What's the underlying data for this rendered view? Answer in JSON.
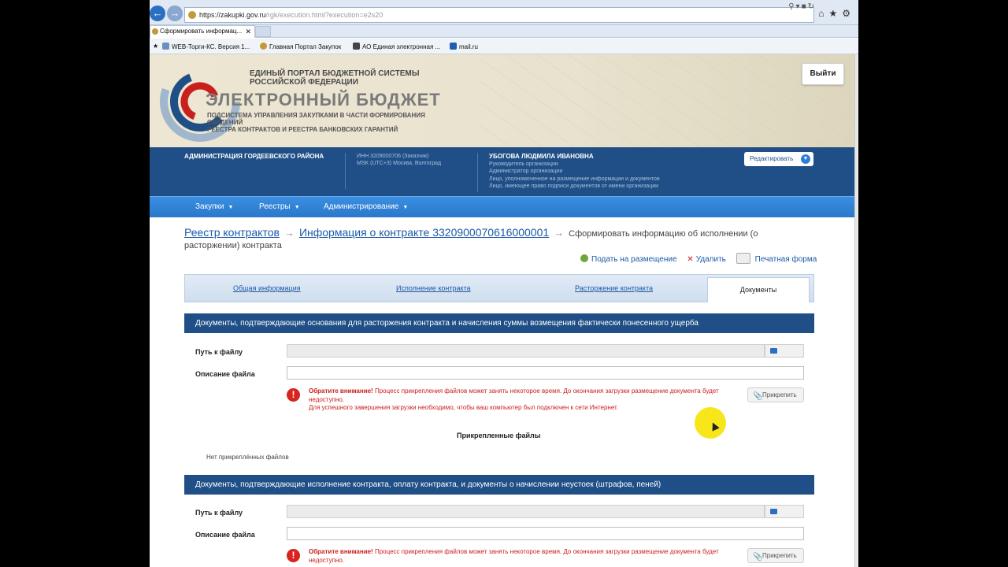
{
  "browser": {
    "url_main": "https://zakupki.gov.ru",
    "url_rest": "/rgk/execution.html?execution=e2s20",
    "tab_title": "Сформировать информац...",
    "favorites": [
      "WEB-Торги-КС. Версия 1...",
      "Главная Портал Закупок",
      "АО Единая электронная ...",
      "mail.ru"
    ]
  },
  "banner": {
    "line1": "ЕДИНЫЙ ПОРТАЛ БЮДЖЕТНОЙ СИСТЕМЫ",
    "line2": "РОССИЙСКОЙ ФЕДЕРАЦИИ",
    "title": "ЭЛЕКТРОННЫЙ БЮДЖЕТ",
    "sub1": "ПОДСИСТЕМА УПРАВЛЕНИЯ ЗАКУПКАМИ В ЧАСТИ ФОРМИРОВАНИЯ СВЕДЕНИЙ",
    "sub2": "РЕЕСТРА КОНТРАКТОВ И РЕЕСТРА БАНКОВСКИХ ГАРАНТИЙ",
    "logout": "Выйти"
  },
  "info": {
    "org": "АДМИНИСТРАЦИЯ ГОРДЕЕВСКОГО РАЙОНА",
    "inn": "ИНН 3209000706 (Заказчик)",
    "tz": "MSK (UTC+3) Москва, Волгоград",
    "user": "УБОГОВА ЛЮДМИЛА ИВАНОВНА",
    "roles": [
      "Руководитель организации",
      "Администратор организации",
      "Лицо, уполномоченное на размещение информации и документов",
      "Лицо, имеющее право подписи документов от имени организации"
    ],
    "edit": "Редактировать"
  },
  "menu": [
    "Закупки",
    "Реестры",
    "Администрирование"
  ],
  "breadcrumb": {
    "reg": "Реестр контрактов",
    "info": "Информация о контракте 3320900070616000001",
    "current": "Сформировать информацию об исполнении (о расторжении) контракта"
  },
  "actions": {
    "publish": "Подать на размещение",
    "delete": "Удалить",
    "print": "Печатная форма"
  },
  "tabs": [
    "Общая информация",
    "Исполнение контракта",
    "Расторжение контракта",
    "Документы"
  ],
  "sections": [
    {
      "header": "Документы, подтверждающие основания для расторжения контракта и начисления суммы возмещения фактически понесенного ущерба"
    },
    {
      "header": "Документы, подтверждающие исполнение контракта, оплату контракта, и документы о начислении неустоек (штрафов, пеней)"
    }
  ],
  "form": {
    "path_label": "Путь к файлу",
    "desc_label": "Описание файла",
    "warn_bold": "Обратите внимание!",
    "warn_text": " Процесс прикрепления файлов может занять некоторое время. До окончания загрузки размещение документа будет недоступно.",
    "warn_line2": "Для успешного завершения загрузки необходимо, чтобы ваш компьютер был подключен к сети Интернет.",
    "attach": "Прикрепить",
    "attached_title": "Прикрепленные файлы",
    "no_files": "Нет прикреплённых файлов"
  }
}
